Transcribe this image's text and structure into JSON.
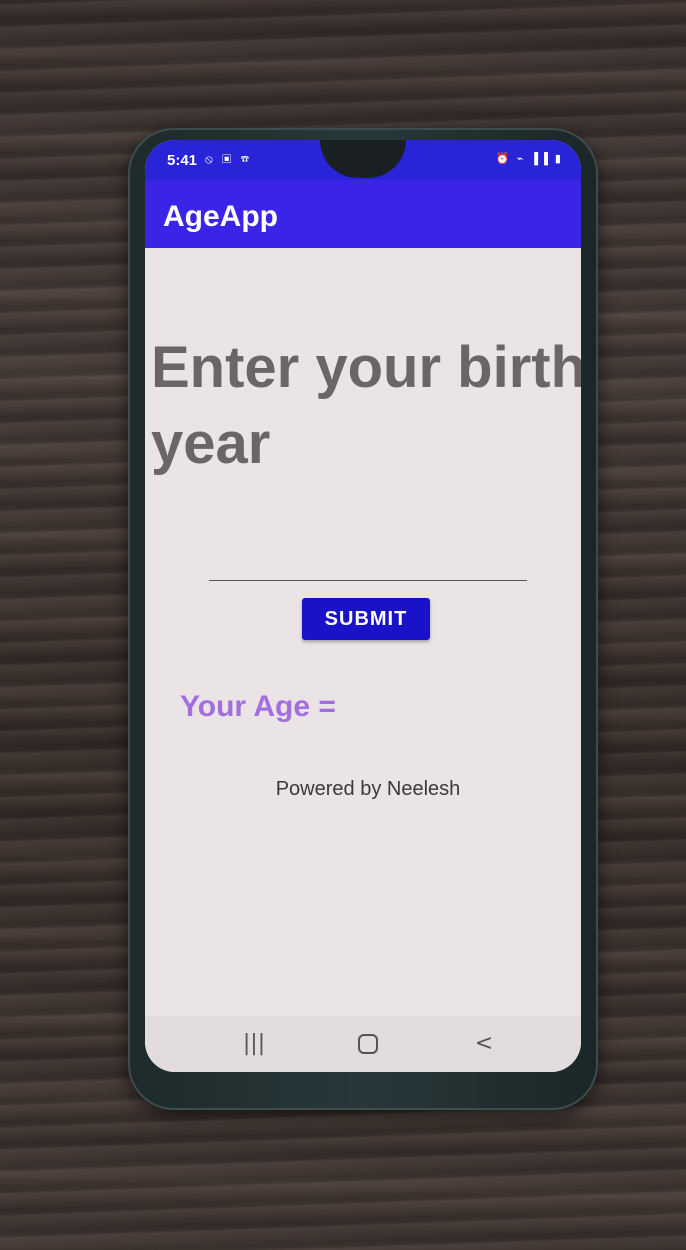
{
  "status_bar": {
    "time": "5:41",
    "left_icons": "⦸ ▣ ☎",
    "right_icons": "⏰ ⌁ ▐▐ ▮"
  },
  "app_bar": {
    "title": "AgeApp"
  },
  "main": {
    "prompt": "Enter your birth year",
    "year_input_value": "",
    "submit_label": "SUBMIT",
    "age_label": "Your Age =",
    "footer": "Powered by Neelesh"
  },
  "nav_bar": {
    "recent_icon": "recent-apps-icon",
    "home_icon": "home-icon",
    "back_icon": "back-icon",
    "recent_glyph": "|||",
    "back_glyph": "<"
  },
  "colors": {
    "status_bar": "#2a24d8",
    "app_bar": "#3a24e8",
    "button": "#1a12c8",
    "age_label": "#a36ee0"
  }
}
